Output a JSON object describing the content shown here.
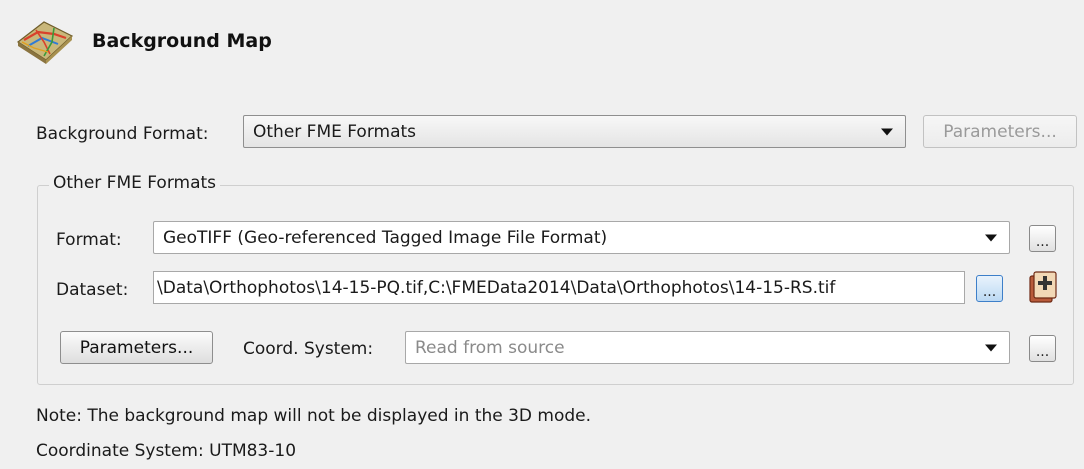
{
  "header": {
    "title": "Background Map",
    "icon": "map-icon"
  },
  "background_format": {
    "label": "Background Format:",
    "value": "Other FME Formats",
    "parameters_button": "Parameters..."
  },
  "group": {
    "title": "Other FME Formats",
    "format_label": "Format:",
    "format_value": "GeoTIFF (Geo-referenced Tagged Image File Format)",
    "format_browse": "...",
    "dataset_label": "Dataset:",
    "dataset_value": "\\Data\\Orthophotos\\14-15-PQ.tif,C:\\FMEData2014\\Data\\Orthophotos\\14-15-RS.tif",
    "dataset_browse": "...",
    "parameters_button": "Parameters...",
    "coord_label": "Coord. System:",
    "coord_placeholder": "Read from source",
    "coord_browse": "..."
  },
  "notes": {
    "note": "Note: The background map will not be displayed in the 3D mode.",
    "coordinate_system": "Coordinate System: UTM83-10"
  },
  "colors": {
    "panel_bg": "#f0f0f0",
    "accent_blue": "#3d7fc9"
  }
}
